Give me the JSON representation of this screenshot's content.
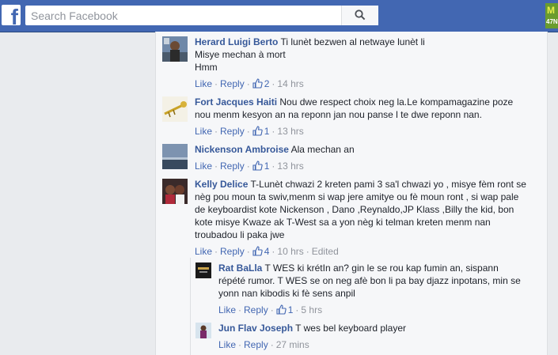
{
  "header": {
    "logo_letter": "f",
    "search_placeholder": "Search Facebook",
    "corner_text_top": "M",
    "corner_text_bottom": "47N"
  },
  "comments": [
    {
      "author": "Herard Luigi Berto",
      "lines": [
        "Ti lunèt bezwen al netwaye lunèt li",
        "Misye mechan à mort",
        "Hmm"
      ],
      "like": "Like",
      "reply": "Reply",
      "likes": "2",
      "time": "14 hrs"
    },
    {
      "author": "Fort Jacques Haiti",
      "lines": [
        "Nou dwe respect choix neg la.Le kompamagazine poze",
        "nou menm kesyon an na reponn jan nou panse l te dwe reponn nan."
      ],
      "like": "Like",
      "reply": "Reply",
      "likes": "1",
      "time": "13 hrs"
    },
    {
      "author": "Nickenson Ambroise",
      "lines": [
        "Ala mechan an"
      ],
      "like": "Like",
      "reply": "Reply",
      "likes": "1",
      "time": "13 hrs"
    },
    {
      "author": "Kelly Delice",
      "lines": [
        "T-Lunèt chwazi 2 kreten pami 3 sa'l chwazi yo , misye fèm ront se",
        "nèg pou moun ta swiv,menm si wap jere amitye ou fè moun ront , si wap pale",
        "de keyboardist kote Nickenson , Dano ,Reynaldo,JP Klass ,Billy the kid, bon",
        "kote misye Kwaze ak T-West sa a yon nèg ki telman kreten menm nan",
        "troubadou li paka jwe"
      ],
      "like": "Like",
      "reply": "Reply",
      "likes": "4",
      "time": "10 hrs",
      "edited": "Edited"
    }
  ],
  "replies": [
    {
      "author": "Rat BaLla",
      "lines": [
        "T WES ki krétIn an? gin le se rou kap fumin an, sispann",
        "répété rumor. T WES se on neg afè bon li pa bay djazz inpotans, min se",
        "yonn nan kibodis ki fè sens anpil"
      ],
      "like": "Like",
      "reply": "Reply",
      "likes": "1",
      "time": "5 hrs"
    },
    {
      "author": "Jun Flav Joseph",
      "lines": [
        "T wes bel keyboard player"
      ],
      "like": "Like",
      "reply": "Reply",
      "time": "27 mins"
    }
  ]
}
